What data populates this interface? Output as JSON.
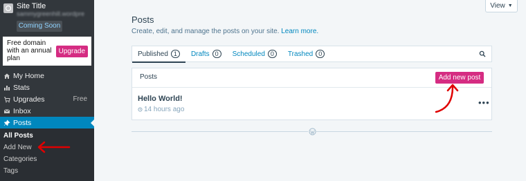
{
  "site": {
    "title": "Site Title",
    "url": "sammygreenhill.wordpre",
    "status": "Coming Soon"
  },
  "promo": {
    "text": "Free domain with an annual plan",
    "button": "Upgrade"
  },
  "sidebar": {
    "items": [
      {
        "label": "My Home",
        "icon": "home-icon"
      },
      {
        "label": "Stats",
        "icon": "stats-icon"
      },
      {
        "label": "Upgrades",
        "icon": "cart-icon",
        "badge": "Free"
      },
      {
        "label": "Inbox",
        "icon": "mail-icon"
      },
      {
        "label": "Posts",
        "icon": "pin-icon",
        "active": true
      }
    ],
    "submenu": [
      "All Posts",
      "Add New",
      "Categories",
      "Tags"
    ]
  },
  "header": {
    "view_label": "View"
  },
  "main": {
    "title": "Posts",
    "subtitle": "Create, edit, and manage the posts on your site.",
    "learn_more": "Learn more.",
    "tabs": [
      {
        "label": "Published",
        "count": "1"
      },
      {
        "label": "Drafts",
        "count": "0"
      },
      {
        "label": "Scheduled",
        "count": "0"
      },
      {
        "label": "Trashed",
        "count": "0"
      }
    ],
    "card": {
      "label": "Posts",
      "add_button": "Add new post",
      "post_title": "Hello World!",
      "post_time": "14 hours ago"
    }
  },
  "colors": {
    "sidebar_bg": "#32373c",
    "active_blue": "#0087be",
    "accent_pink": "#d52c82",
    "annotation_red": "#e00000"
  }
}
